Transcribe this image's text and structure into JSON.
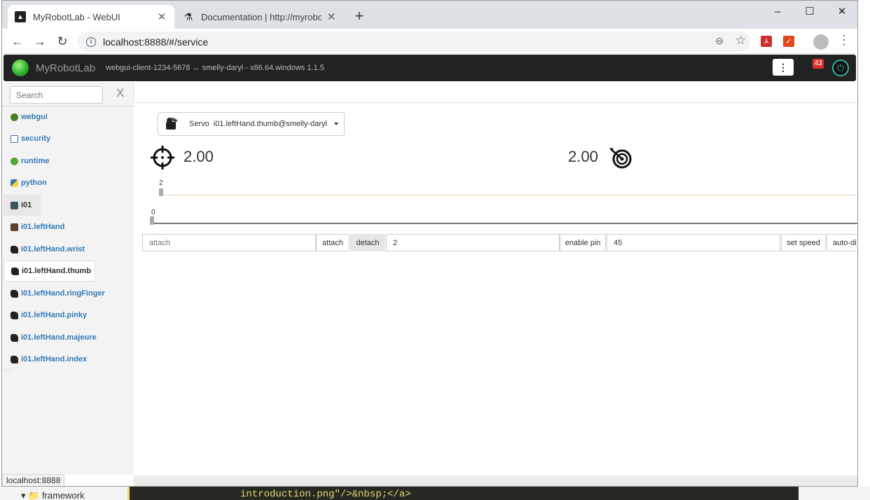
{
  "browser": {
    "tabs": [
      {
        "title": "MyRobotLab - WebUI",
        "favicon": "mrl-icon"
      },
      {
        "title": "Documentation | http://myrobotl",
        "favicon": "flask-icon"
      }
    ],
    "new_tab_label": "+",
    "url": "localhost:8888/#/service",
    "status_url": "localhost:8888",
    "window_controls": [
      "–",
      "☐",
      "✕"
    ]
  },
  "app": {
    "brand": "MyRobotLab",
    "client_info": "webgui-client-1234-5678 ↔ smelly-daryl - x86.64.windows 1.1.5",
    "menu_icon": "⋮",
    "notification_count": "43",
    "power_icon": "⏻"
  },
  "sidebar": {
    "search_placeholder": "Search",
    "clear_label": "X",
    "items": [
      {
        "label": "webgui",
        "icon": "globe-icon",
        "color": "#4a7f2a"
      },
      {
        "label": "security",
        "icon": "lock-icon",
        "color": "#3c6cb0"
      },
      {
        "label": "runtime",
        "icon": "gear-icon",
        "color": "#58a63a"
      },
      {
        "label": "python",
        "icon": "python-icon",
        "color": "#3776ab"
      },
      {
        "label": "i01",
        "icon": "inmoov-icon",
        "color": "#3d5560"
      },
      {
        "label": "i01.leftHand",
        "icon": "hand-icon",
        "color": "#5a4030"
      },
      {
        "label": "i01.leftHand.wrist",
        "icon": "servo-icon",
        "color": "#222222"
      },
      {
        "label": "i01.leftHand.thumb",
        "icon": "servo-icon",
        "color": "#222222"
      },
      {
        "label": "i01.leftHand.ringFinger",
        "icon": "servo-icon",
        "color": "#222222"
      },
      {
        "label": "i01.leftHand.pinky",
        "icon": "servo-icon",
        "color": "#222222"
      },
      {
        "label": "i01.leftHand.majeure",
        "icon": "servo-icon",
        "color": "#222222"
      },
      {
        "label": "i01.leftHand.index",
        "icon": "servo-icon",
        "color": "#222222"
      }
    ]
  },
  "service": {
    "selector_type": "Servo",
    "selector_name": "i01.leftHand.thumb@smelly-daryl",
    "current_pos": "2.00",
    "target_pos": "2.00",
    "slider_top_value": "2",
    "slider_bottom_value": "0",
    "controls": {
      "attach_placeholder": "attach",
      "attach_label": "attach",
      "detach_label": "detach",
      "pin_value": "2",
      "enable_pin_label": "enable pin",
      "speed_value": "45",
      "set_speed_label": "set speed",
      "auto_disable_label": "auto-di"
    }
  },
  "background": {
    "editor_text": "introduction.png\"/>&nbsp;</a>",
    "folder_label": "framework"
  }
}
